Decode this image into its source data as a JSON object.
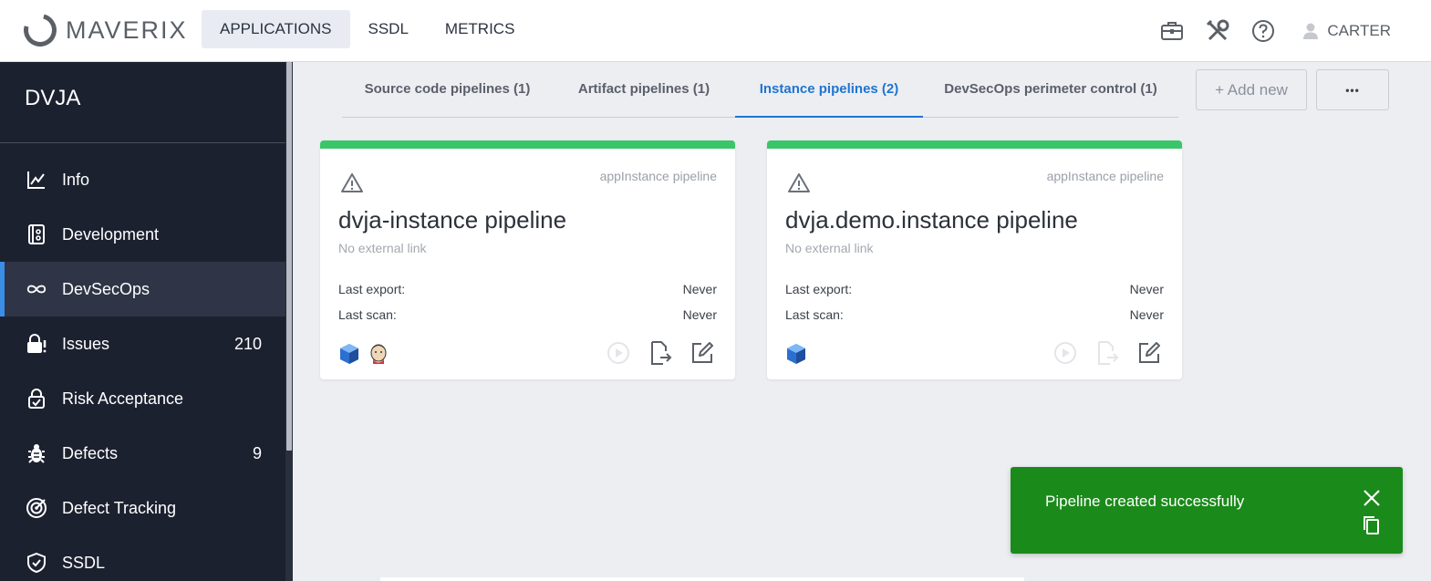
{
  "header": {
    "logo_text": "MAVERIX",
    "nav": [
      "APPLICATIONS",
      "SSDL",
      "METRICS"
    ],
    "active_nav": "APPLICATIONS",
    "user": "CARTER",
    "icons": [
      "briefcase-icon",
      "tools-icon",
      "help-icon",
      "user-icon"
    ]
  },
  "sidebar": {
    "app_name": "DVJA",
    "items": [
      {
        "label": "Info",
        "icon": "chart-line-icon",
        "count": ""
      },
      {
        "label": "Development",
        "icon": "repository-icon",
        "count": ""
      },
      {
        "label": "DevSecOps",
        "icon": "infinity-icon",
        "count": "",
        "active": true
      },
      {
        "label": "Issues",
        "icon": "lock-alert-icon",
        "count": "210"
      },
      {
        "label": "Risk Acceptance",
        "icon": "lock-check-icon",
        "count": ""
      },
      {
        "label": "Defects",
        "icon": "bug-icon",
        "count": "9"
      },
      {
        "label": "Defect Tracking",
        "icon": "target-icon",
        "count": ""
      },
      {
        "label": "SSDL",
        "icon": "shield-check-icon",
        "count": ""
      }
    ]
  },
  "tabs": {
    "items": [
      {
        "label": "Source code pipelines (1)"
      },
      {
        "label": "Artifact pipelines (1)"
      },
      {
        "label": "Instance pipelines (2)",
        "active": true
      },
      {
        "label": "DevSecOps perimeter control (1)"
      }
    ],
    "add_new_label": "+ Add new",
    "more_label": "•••"
  },
  "cards": [
    {
      "type_label": "appInstance pipeline",
      "title": "dvja-instance pipeline",
      "link": "No external link",
      "last_export_label": "Last export:",
      "last_export_value": "Never",
      "last_scan_label": "Last scan:",
      "last_scan_value": "Never",
      "tools": [
        "cube-tool-icon",
        "jenkins-tool-icon"
      ],
      "export_enabled": true
    },
    {
      "type_label": "appInstance pipeline",
      "title": "dvja.demo.instance pipeline",
      "link": "No external link",
      "last_export_label": "Last export:",
      "last_export_value": "Never",
      "last_scan_label": "Last scan:",
      "last_scan_value": "Never",
      "tools": [
        "cube-tool-icon"
      ],
      "export_enabled": false
    }
  ],
  "toast": {
    "message": "Pipeline created successfully",
    "color": "#1a8a1a"
  },
  "colors": {
    "accent": "#1f74d2",
    "card_status": "#3ac569",
    "sidebar_bg": "#1c2130"
  }
}
